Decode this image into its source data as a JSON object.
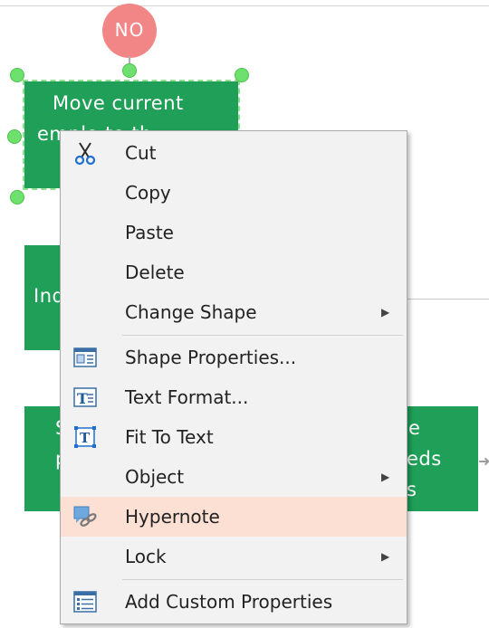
{
  "diagram": {
    "decision_label": "NO",
    "shape_selected": {
      "line1": "Move current",
      "line2": "emplo    to th"
    },
    "shape_left_middle": {
      "text": "Ind"
    },
    "shape_left_bottom": {
      "line1": "S",
      "line2": "p"
    },
    "shape_right_bottom": {
      "line1": "e",
      "line2": "eds",
      "line3": "s"
    }
  },
  "context_menu": {
    "items": [
      {
        "label": "Cut",
        "icon": "scissors-icon",
        "has_submenu": false
      },
      {
        "label": "Copy",
        "icon": null,
        "has_submenu": false
      },
      {
        "label": "Paste",
        "icon": null,
        "has_submenu": false
      },
      {
        "label": "Delete",
        "icon": null,
        "has_submenu": false
      },
      {
        "label": "Change Shape",
        "icon": null,
        "has_submenu": true
      },
      {
        "label": "Shape Properties...",
        "icon": "shape-properties-icon",
        "has_submenu": false
      },
      {
        "label": "Text Format...",
        "icon": "text-format-icon",
        "has_submenu": false
      },
      {
        "label": "Fit To Text",
        "icon": "fit-to-text-icon",
        "has_submenu": false
      },
      {
        "label": "Object",
        "icon": null,
        "has_submenu": true
      },
      {
        "label": "Hypernote",
        "icon": "hypernote-icon",
        "has_submenu": false,
        "highlighted": true
      },
      {
        "label": "Lock",
        "icon": null,
        "has_submenu": true
      },
      {
        "label": "Add Custom Properties",
        "icon": "custom-properties-icon",
        "has_submenu": false
      }
    ]
  },
  "colors": {
    "shape_fill": "#1f9f57",
    "decision_fill": "#f28585",
    "selection_handle": "#6ee06e",
    "menu_bg": "#f2f2f2",
    "menu_highlight": "#fde0d4"
  }
}
